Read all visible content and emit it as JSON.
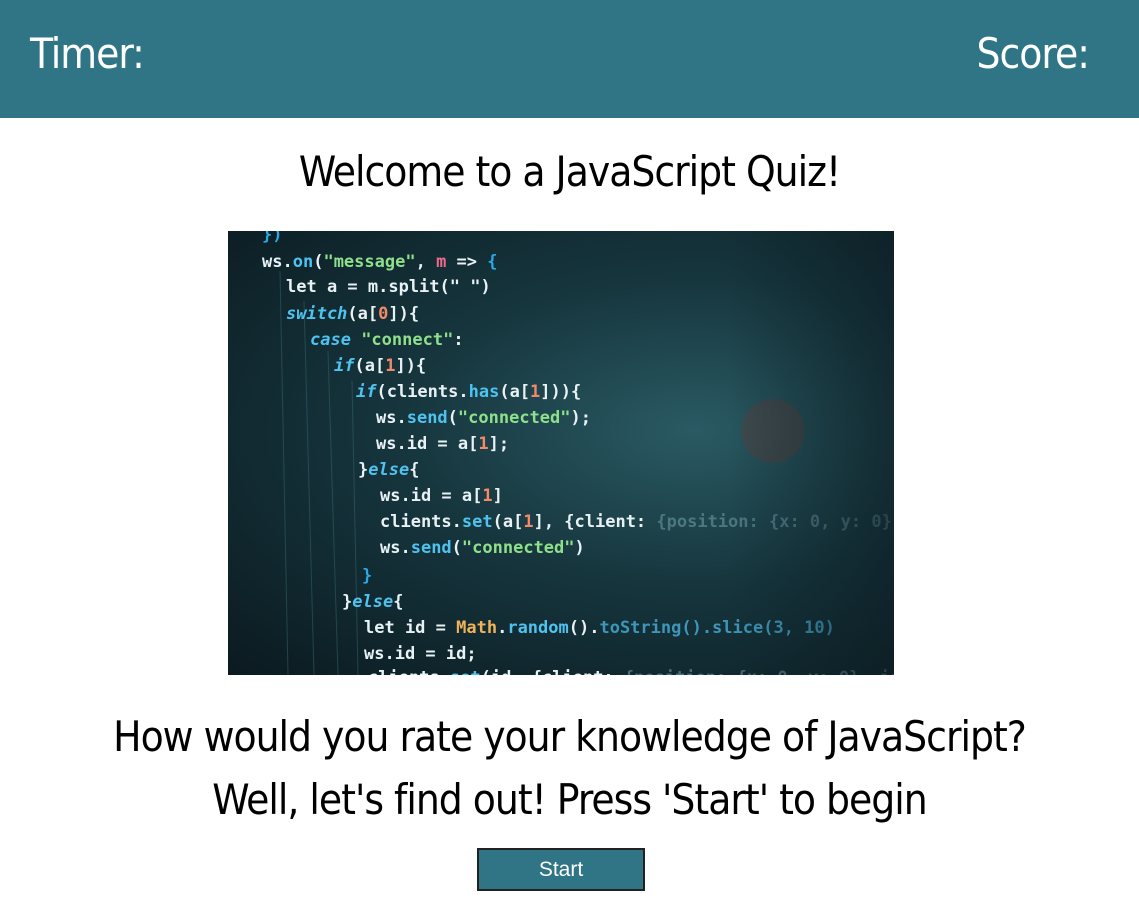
{
  "header": {
    "timer_label": "Timer:",
    "score_label": "Score:",
    "background_color": "#307585"
  },
  "main": {
    "welcome_title": "Welcome to a JavaScript Quiz!",
    "image_description_icon": "code-screenshot-image",
    "prompt_line1": "How would you rate your knowledge of JavaScript?",
    "prompt_line2": "Well, let's find out! Press 'Start' to begin",
    "start_button_label": "Start"
  }
}
